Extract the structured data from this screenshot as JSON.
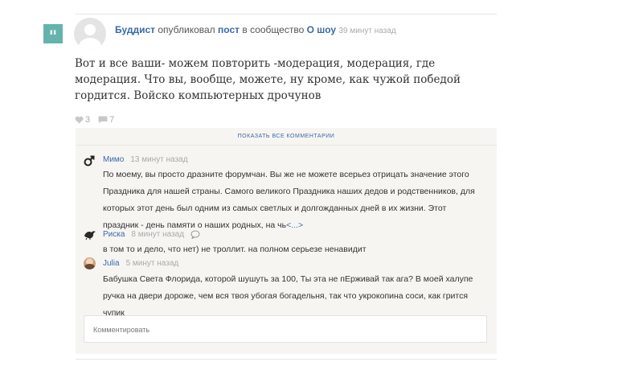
{
  "post": {
    "author": "Буддист",
    "action": "опубликовал",
    "object": "пост",
    "in_text": "в сообщество",
    "community": "О шоу",
    "time": "39 минут назад",
    "text": "Вот и все ваши- можем повторить -модерация, модерация, где модерация. Что вы, вообще, можете, ну кроме, как чужой победой гордится. Войско компьютерных дрочунов",
    "likes": "3",
    "comments": "7"
  },
  "comments_section": {
    "show_all_label": "ПОКАЗАТЬ ВСЕ КОММЕНТАРИИ",
    "input_placeholder": "Комментировать",
    "items": [
      {
        "author": "Мимо",
        "time": "13 минут назад",
        "icon": "male-symbol-icon",
        "text": "По моему, вы просто дразните форумчан. Вы же не можете всерьез отрицать значение этого Праздника для нашей страны. Самого великого Праздника наших дедов и родственников, для которых этот день был одним из самых светлых и долгожданных дней в их жизни. Этот праздник - день памяти о наших родных, на чь",
        "more": "<...>"
      },
      {
        "author": "Риска",
        "time": "8 минут назад",
        "icon": "bird-avatar-icon",
        "text": "в том то и дело, что нет) не троллит. на полном серьезе ненавидит"
      },
      {
        "author": "Julia",
        "time": "5 минут назад",
        "icon": "user-photo-avatar",
        "text": "Бабушка Света Флорида, которой шушуть за 100, Ты эта не пЕрживай так ага? В моей халупе ручка на двери дороже, чем вся твоя убогая богадельня, так что укрокопина соси, как грится чупик"
      }
    ]
  },
  "colors": {
    "accent": "#3a6aa6",
    "quote_badge": "#65b3ad",
    "panel_bg": "#f7f5f2"
  }
}
